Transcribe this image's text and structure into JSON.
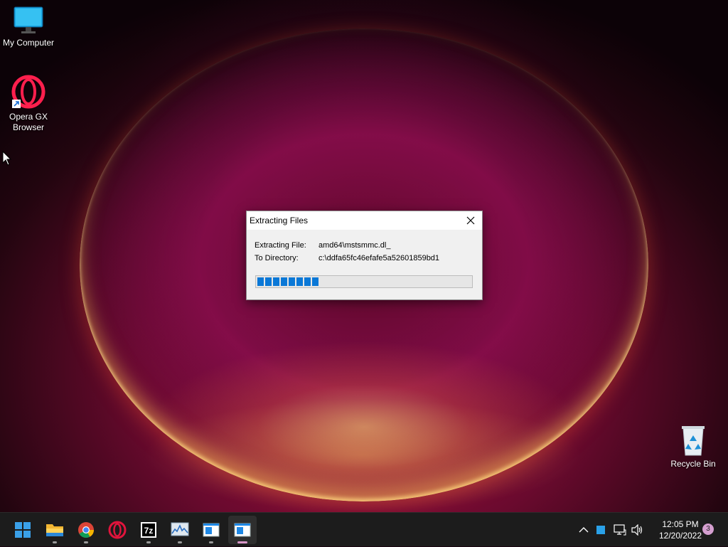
{
  "desktop": {
    "icons": [
      {
        "label": "My Computer"
      },
      {
        "label_line1": "Opera GX",
        "label_line2": "Browser"
      },
      {
        "label": "Recycle Bin"
      }
    ]
  },
  "dialog": {
    "title": "Extracting Files",
    "file_label": "Extracting File:",
    "file_value": "amd64\\mstsmmc.dl_",
    "dir_label": "To Directory:",
    "dir_value": "c:\\ddfa65fc46efafe5a52601859bd1",
    "progress_fraction": 0.31,
    "progress_color": "#0a78d7"
  },
  "taskbar": {
    "apps": [
      "start-icon",
      "file-explorer-icon",
      "chrome-icon",
      "opera-icon",
      "7zip-icon",
      "resource-monitor-icon",
      "window-app-icon",
      "window-app-icon-active"
    ],
    "clock": {
      "time": "12:05 PM",
      "date": "12/20/2022"
    },
    "notification_count": "3"
  }
}
